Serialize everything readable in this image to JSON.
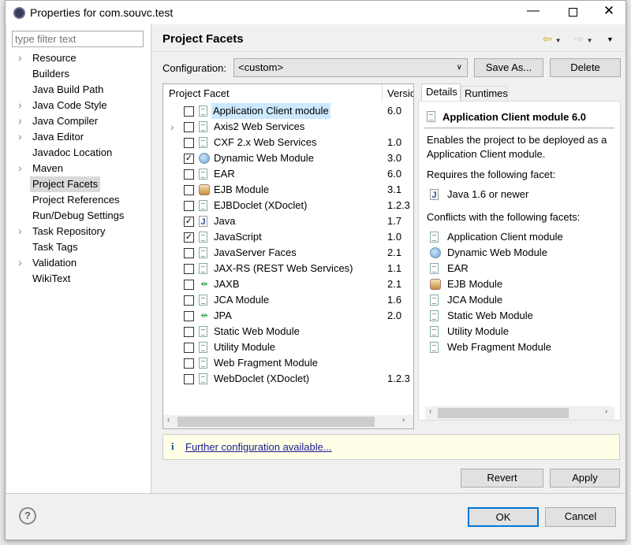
{
  "window": {
    "title": "Properties for com.souvc.test"
  },
  "filter": {
    "placeholder": "type filter text"
  },
  "tree": [
    {
      "label": "Resource",
      "expandable": true
    },
    {
      "label": "Builders",
      "expandable": false
    },
    {
      "label": "Java Build Path",
      "expandable": false
    },
    {
      "label": "Java Code Style",
      "expandable": true
    },
    {
      "label": "Java Compiler",
      "expandable": true
    },
    {
      "label": "Java Editor",
      "expandable": true
    },
    {
      "label": "Javadoc Location",
      "expandable": false
    },
    {
      "label": "Maven",
      "expandable": true
    },
    {
      "label": "Project Facets",
      "expandable": false,
      "selected": true
    },
    {
      "label": "Project References",
      "expandable": false
    },
    {
      "label": "Run/Debug Settings",
      "expandable": false
    },
    {
      "label": "Task Repository",
      "expandable": true
    },
    {
      "label": "Task Tags",
      "expandable": false
    },
    {
      "label": "Validation",
      "expandable": true
    },
    {
      "label": "WikiText",
      "expandable": false
    }
  ],
  "page": {
    "title": "Project Facets",
    "config_label": "Configuration:",
    "config_value": "<custom>",
    "save_as": "Save As...",
    "delete": "Delete"
  },
  "facets_table": {
    "col_facet": "Project Facet",
    "col_version": "Versic",
    "rows": [
      {
        "name": "Application Client module",
        "version": "6.0",
        "checked": false,
        "icon": "doc",
        "selected": true
      },
      {
        "name": "Axis2 Web Services",
        "version": "",
        "checked": false,
        "icon": "doc",
        "expandable": true
      },
      {
        "name": "CXF 2.x Web Services",
        "version": "1.0",
        "checked": false,
        "icon": "doc"
      },
      {
        "name": "Dynamic Web Module",
        "version": "3.0",
        "checked": true,
        "icon": "globe"
      },
      {
        "name": "EAR",
        "version": "6.0",
        "checked": false,
        "icon": "doc"
      },
      {
        "name": "EJB Module",
        "version": "3.1",
        "checked": false,
        "icon": "bean"
      },
      {
        "name": "EJBDoclet (XDoclet)",
        "version": "1.2.3",
        "checked": false,
        "icon": "doc"
      },
      {
        "name": "Java",
        "version": "1.7",
        "checked": true,
        "icon": "java"
      },
      {
        "name": "JavaScript",
        "version": "1.0",
        "checked": true,
        "icon": "doc"
      },
      {
        "name": "JavaServer Faces",
        "version": "2.1",
        "checked": false,
        "icon": "doc"
      },
      {
        "name": "JAX-RS (REST Web Services)",
        "version": "1.1",
        "checked": false,
        "icon": "doc"
      },
      {
        "name": "JAXB",
        "version": "2.1",
        "checked": false,
        "icon": "arrows"
      },
      {
        "name": "JCA Module",
        "version": "1.6",
        "checked": false,
        "icon": "doc"
      },
      {
        "name": "JPA",
        "version": "2.0",
        "checked": false,
        "icon": "arrows"
      },
      {
        "name": "Static Web Module",
        "version": "",
        "checked": false,
        "icon": "doc"
      },
      {
        "name": "Utility Module",
        "version": "",
        "checked": false,
        "icon": "doc"
      },
      {
        "name": "Web Fragment Module",
        "version": "",
        "checked": false,
        "icon": "doc"
      },
      {
        "name": "WebDoclet (XDoclet)",
        "version": "1.2.3",
        "checked": false,
        "icon": "doc"
      }
    ]
  },
  "details": {
    "tabs": [
      "Details",
      "Runtimes"
    ],
    "heading": "Application Client module 6.0",
    "description": "Enables the project to be deployed as a Application Client module.",
    "requires_label": "Requires the following facet:",
    "requires": [
      {
        "name": "Java 1.6 or newer",
        "icon": "java"
      }
    ],
    "conflicts_label": "Conflicts with the following facets:",
    "conflicts": [
      {
        "name": "Application Client module",
        "icon": "doc"
      },
      {
        "name": "Dynamic Web Module",
        "icon": "globe"
      },
      {
        "name": "EAR",
        "icon": "doc"
      },
      {
        "name": "EJB Module",
        "icon": "bean"
      },
      {
        "name": "JCA Module",
        "icon": "doc"
      },
      {
        "name": "Static Web Module",
        "icon": "doc"
      },
      {
        "name": "Utility Module",
        "icon": "doc"
      },
      {
        "name": "Web Fragment Module",
        "icon": "doc"
      }
    ]
  },
  "info": {
    "icon": "info-icon",
    "link": "Further configuration available..."
  },
  "buttons": {
    "revert": "Revert",
    "apply": "Apply",
    "ok": "OK",
    "cancel": "Cancel"
  }
}
